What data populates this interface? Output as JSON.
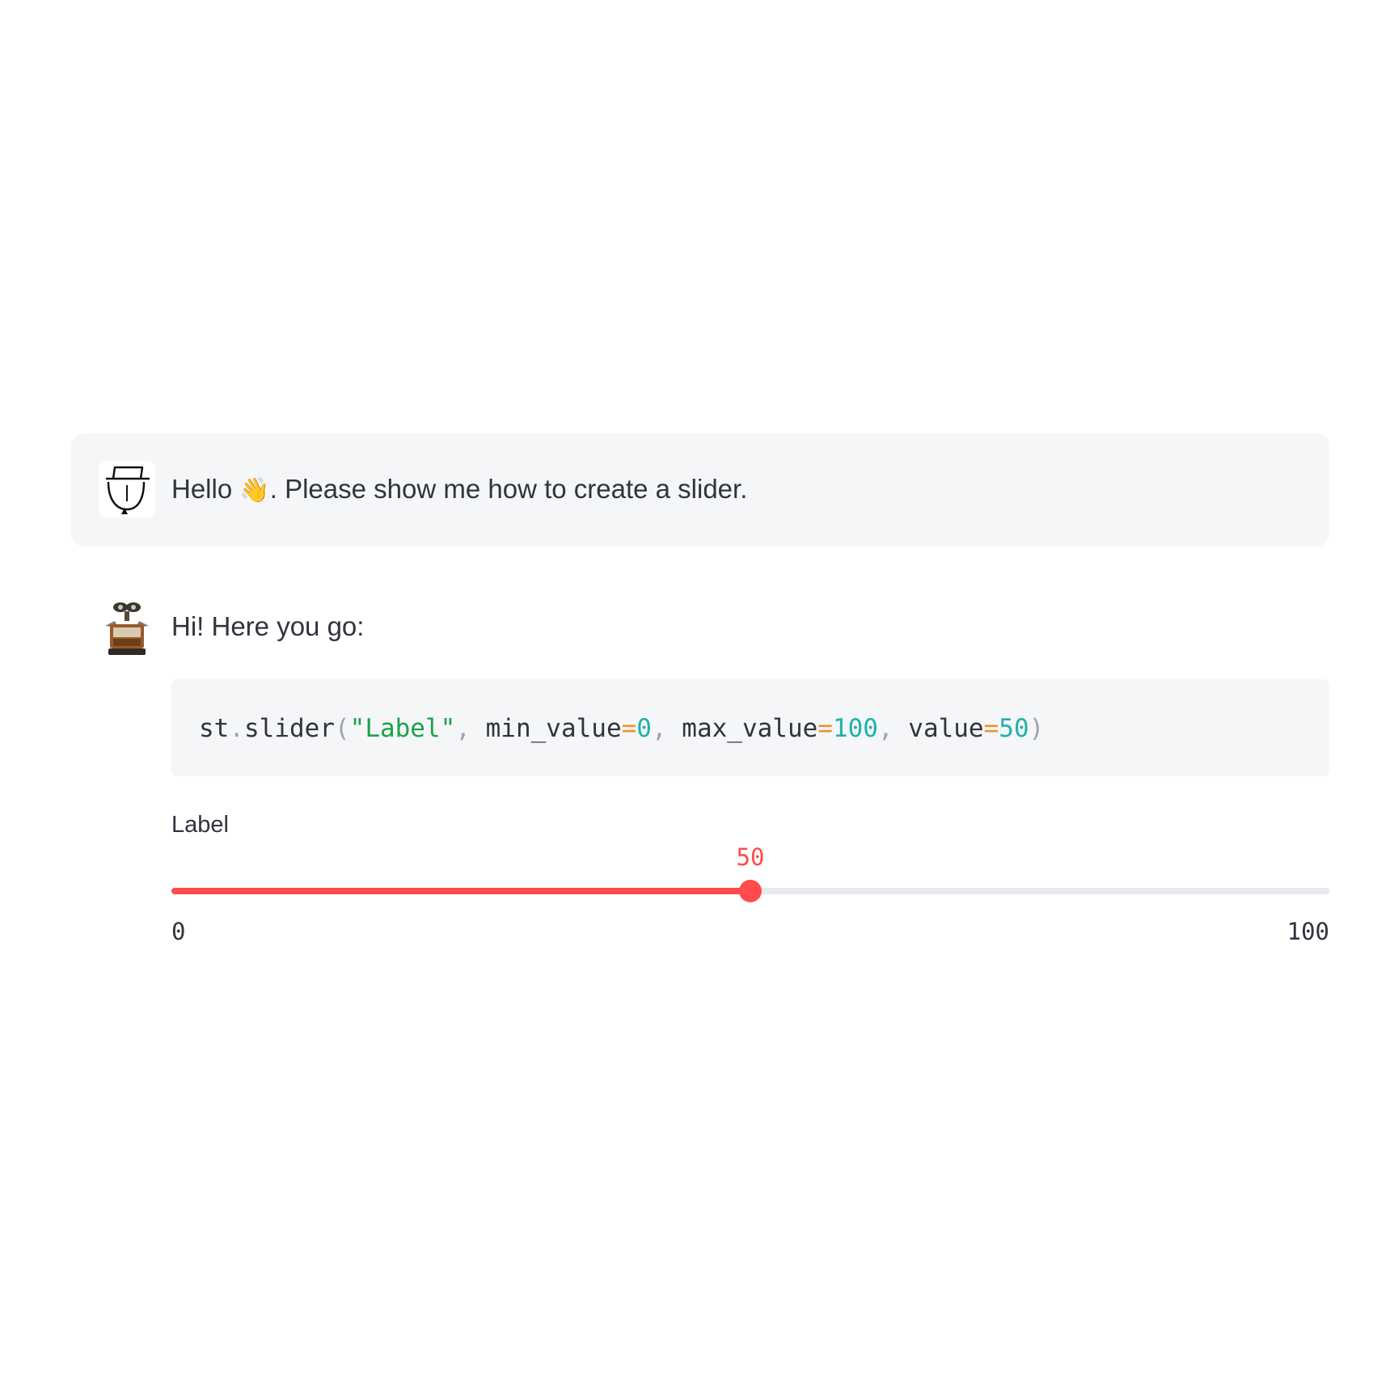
{
  "chat": {
    "user_message": {
      "text_before_emoji": "Hello ",
      "emoji": "👋",
      "text_after_emoji": ". Please show me how to create a slider.",
      "avatar_icon": "line-drawing-avatar-icon"
    },
    "assistant_message": {
      "text": "Hi! Here you go:",
      "avatar_icon": "robot-avatar-icon",
      "code": {
        "tokens": [
          {
            "text": "st",
            "kind": "plain"
          },
          {
            "text": ".",
            "kind": "punc"
          },
          {
            "text": "slider",
            "kind": "plain"
          },
          {
            "text": "(",
            "kind": "punc"
          },
          {
            "text": "\"Label\"",
            "kind": "str"
          },
          {
            "text": ", ",
            "kind": "punc"
          },
          {
            "text": "min_value",
            "kind": "plain"
          },
          {
            "text": "=",
            "kind": "op"
          },
          {
            "text": "0",
            "kind": "num"
          },
          {
            "text": ", ",
            "kind": "punc"
          },
          {
            "text": "max_value",
            "kind": "plain"
          },
          {
            "text": "=",
            "kind": "op"
          },
          {
            "text": "100",
            "kind": "num"
          },
          {
            "text": ", ",
            "kind": "punc"
          },
          {
            "text": "value",
            "kind": "plain"
          },
          {
            "text": "=",
            "kind": "op"
          },
          {
            "text": "50",
            "kind": "num"
          },
          {
            "text": ")",
            "kind": "punc"
          }
        ]
      }
    }
  },
  "slider": {
    "label": "Label",
    "min": 0,
    "max": 100,
    "value": 50,
    "min_label": "0",
    "max_label": "100",
    "value_label": "50",
    "accent_color": "#ff4b4b",
    "track_color": "#e8e9ee"
  }
}
